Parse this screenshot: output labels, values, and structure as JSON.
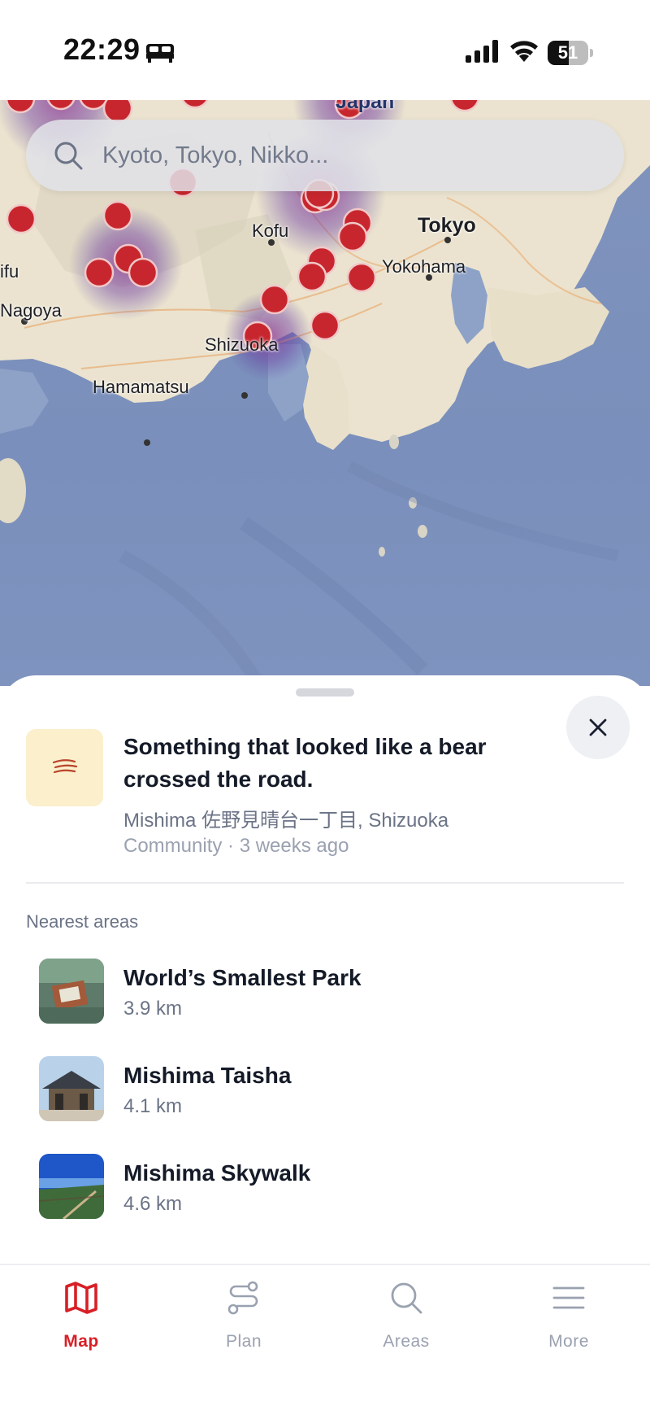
{
  "status_bar": {
    "time": "22:29",
    "battery": "51",
    "battery_level": 0.51
  },
  "search": {
    "placeholder": "Kyoto, Tokyo, Nikko..."
  },
  "map": {
    "labels": {
      "japan": "Japan",
      "kofu": "Kofu",
      "tokyo": "Tokyo",
      "yokohama": "Yokohama",
      "gifu": "ifu",
      "nagoya": "Nagoya",
      "shizuoka": "Shizuoka",
      "hamamatsu": "Hamamatsu"
    },
    "marker_color": "#c8262e"
  },
  "report": {
    "title": "Something that looked like a bear crossed the road.",
    "location": "Mishima 佐野見晴台一丁目, Shizuoka",
    "meta": "Community · 3 weeks ago"
  },
  "nearest": {
    "heading": "Nearest areas",
    "areas": [
      {
        "name": "World’s Smallest Park",
        "distance": "3.9 km"
      },
      {
        "name": "Mishima Taisha",
        "distance": "4.1 km"
      },
      {
        "name": "Mishima Skywalk",
        "distance": "4.6 km"
      }
    ]
  },
  "tabs": [
    {
      "label": "Map",
      "icon": "map-icon",
      "active": true
    },
    {
      "label": "Plan",
      "icon": "route-icon",
      "active": false
    },
    {
      "label": "Areas",
      "icon": "search-icon",
      "active": false
    },
    {
      "label": "More",
      "icon": "menu-icon",
      "active": false
    }
  ],
  "colors": {
    "accent": "#d81f26",
    "text": "#141a27",
    "secondary": "#6b7386"
  }
}
